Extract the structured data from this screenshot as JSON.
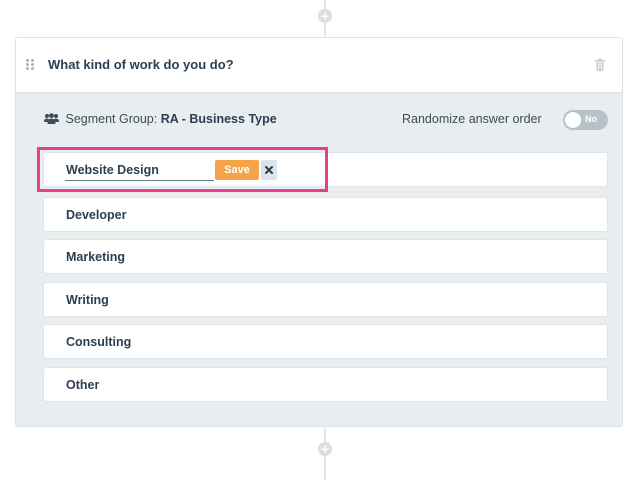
{
  "question": {
    "title": "What kind of work do you do?",
    "icons": {
      "drag": "drag-handle-icon",
      "delete": "trash-icon"
    }
  },
  "segment": {
    "label": "Segment Group:",
    "value": "RA - Business Type",
    "icon": "users-icon"
  },
  "randomize": {
    "label": "Randomize answer order",
    "toggle_text": "No",
    "enabled": false
  },
  "editing": {
    "value": "Website Design",
    "save_label": "Save",
    "cancel_icon": "close-icon"
  },
  "answers": [
    {
      "label": "Developer"
    },
    {
      "label": "Marketing"
    },
    {
      "label": "Writing"
    },
    {
      "label": "Consulting"
    },
    {
      "label": "Other"
    }
  ],
  "colors": {
    "accent": "#f6a44a",
    "highlight": "#e83e8c",
    "panel": "#e8edf0"
  }
}
